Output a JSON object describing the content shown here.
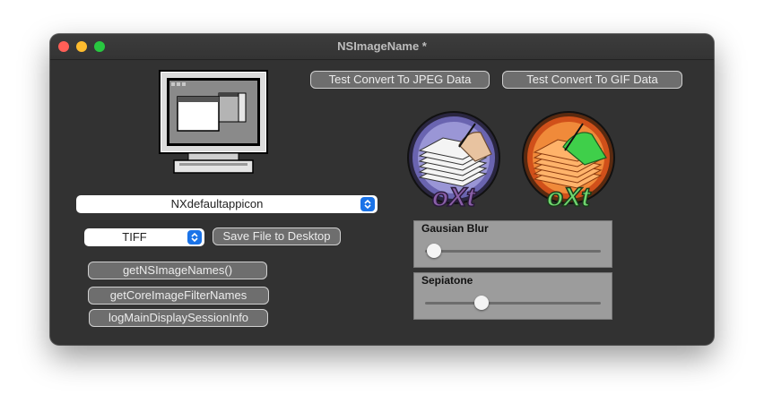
{
  "window": {
    "title": "NSImageName *"
  },
  "toolbar": {
    "jpeg_button": "Test Convert To JPEG Data",
    "gif_button": "Test Convert To GIF Data"
  },
  "image_name_popup": {
    "value": "NXdefaultappicon"
  },
  "format_popup": {
    "value": "TIFF"
  },
  "save_button": "Save File to Desktop",
  "actions": [
    {
      "label": "getNSImageNames()"
    },
    {
      "label": "getCoreImageFilterNames"
    },
    {
      "label": "logMainDisplaySessionInfo"
    }
  ],
  "sliders": {
    "blur": {
      "label": "Gausian Blur",
      "value": 0.05
    },
    "sepia": {
      "label": "Sepiatone",
      "value": 0.32
    }
  },
  "logos": {
    "left_text": "oXt",
    "right_text": "oXt"
  },
  "colors": {
    "accent": "#1a73e8",
    "logo_purple": "#8a5fa8",
    "logo_green": "#6fd66f"
  }
}
